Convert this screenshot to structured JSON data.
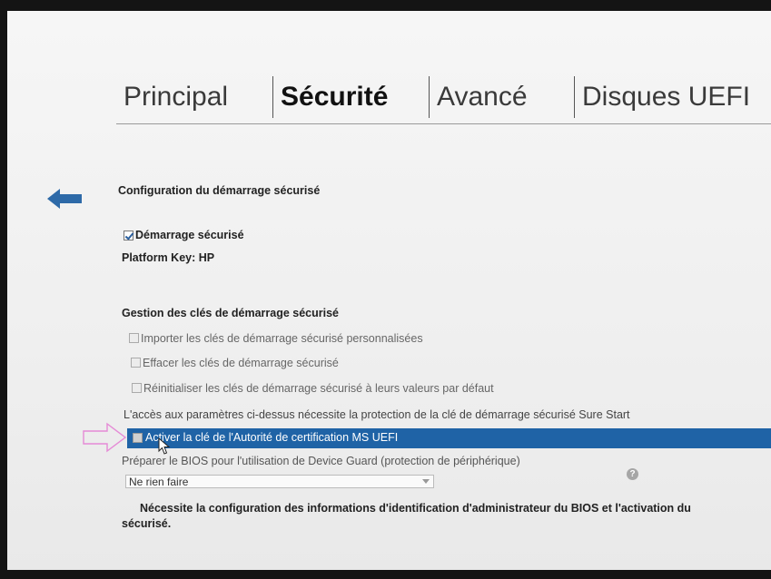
{
  "tabs": [
    {
      "label": "Principal",
      "active": false
    },
    {
      "label": "Sécurité",
      "active": true
    },
    {
      "label": "Avancé",
      "active": false
    },
    {
      "label": "Disques UEFI",
      "active": false
    }
  ],
  "section1": {
    "title": "Configuration du démarrage sécurisé",
    "secure_boot_label": "Démarrage sécurisé",
    "secure_boot_checked": true,
    "platform_key": "Platform Key: HP"
  },
  "section2": {
    "title": "Gestion des clés de démarrage sécurisé",
    "options": [
      {
        "label": "Importer les clés de démarrage sécurisé personnalisées",
        "checked": false
      },
      {
        "label": "Effacer les clés de démarrage sécurisé",
        "checked": false
      },
      {
        "label": "Réinitialiser les clés de démarrage sécurisé à leurs valeurs par défaut",
        "checked": false
      }
    ],
    "note": "L'accès aux paramètres ci-dessus nécessite la protection de la clé de démarrage sécurisé Sure Start",
    "ms_uefi_label": "Activer la clé de l'Autorité de certification MS UEFI",
    "ms_uefi_checked": false
  },
  "device_guard": {
    "label": "Préparer le BIOS pour l'utilisation de Device Guard (protection de périphérique)",
    "selected": "Ne rien faire",
    "help_symbol": "?"
  },
  "footer_note": {
    "line1": "Nécessite la configuration des informations d'identification d'administrateur du BIOS et l'activation du",
    "line2": "sécurisé."
  },
  "colors": {
    "highlight": "#1f63a6",
    "back_arrow": "#2e6aa8",
    "annotation_arrow": "#e58ad6"
  },
  "icons": {
    "back": "back-arrow-icon",
    "help": "help-icon",
    "cursor": "mouse-cursor-icon",
    "annotation": "pink-outline-arrow"
  }
}
